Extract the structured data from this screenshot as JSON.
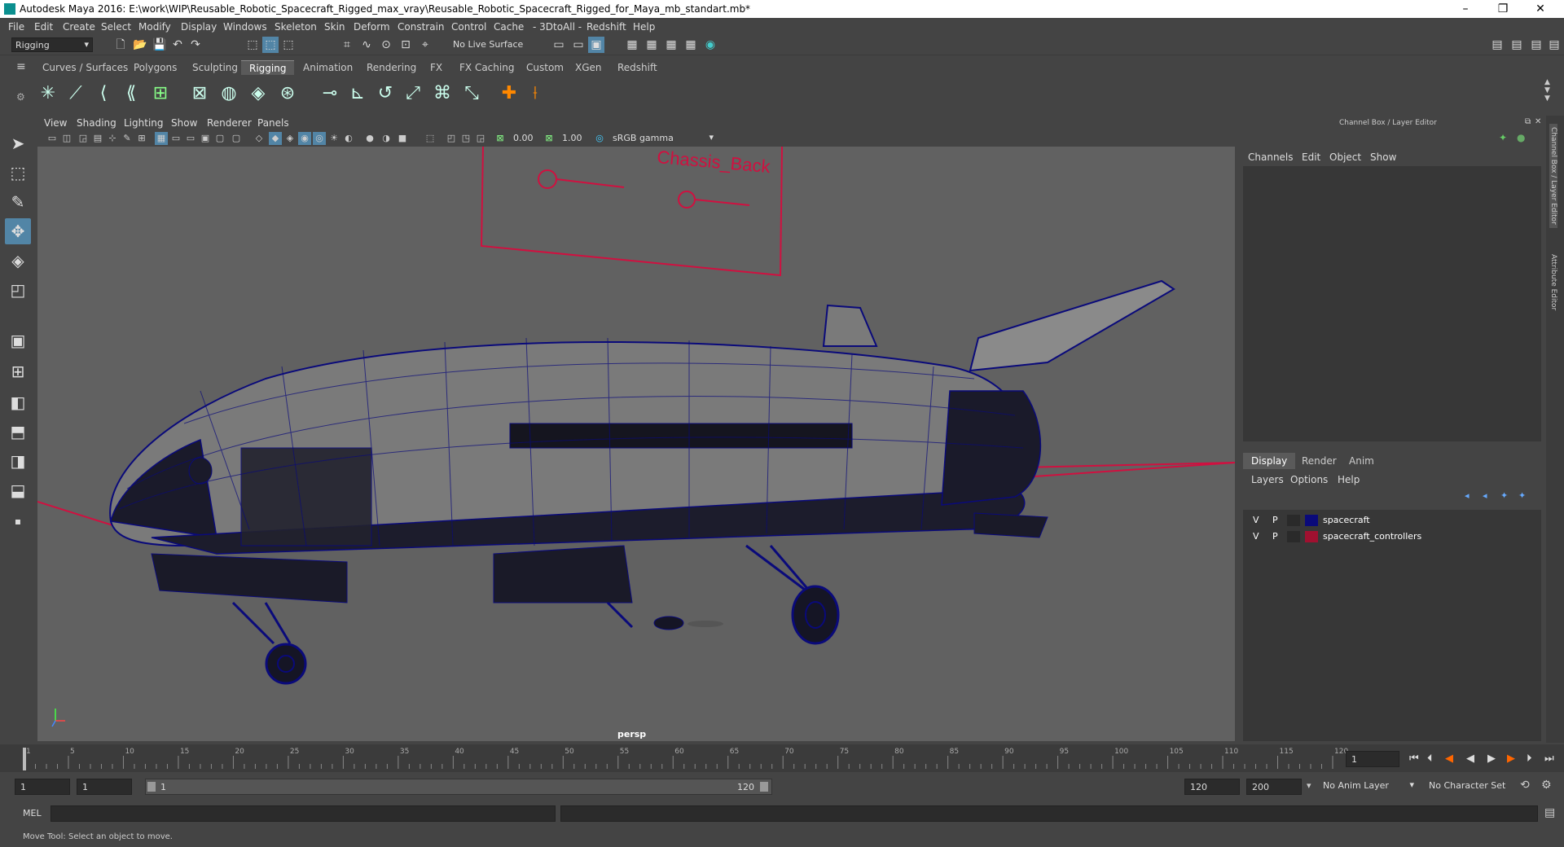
{
  "window": {
    "title": "Autodesk Maya 2016: E:\\work\\WIP\\Reusable_Robotic_Spacecraft_Rigged_max_vray\\Reusable_Robotic_Spacecraft_Rigged_for_Maya_mb_standart.mb*",
    "minimize": "–",
    "maximize": "❐",
    "close": "✕"
  },
  "menubar": [
    "File",
    "Edit",
    "Create",
    "Select",
    "Modify",
    "Display",
    "Windows",
    "Skeleton",
    "Skin",
    "Deform",
    "Constrain",
    "Control",
    "Cache",
    "- 3DtoAll -",
    "Redshift",
    "Help"
  ],
  "statusline": {
    "menuset": "Rigging",
    "live_surface": "No Live Surface"
  },
  "shelf_tabs": [
    "Curves / Surfaces",
    "Polygons",
    "Sculpting",
    "Rigging",
    "Animation",
    "Rendering",
    "FX",
    "FX Caching",
    "Custom",
    "XGen",
    "Redshift"
  ],
  "active_shelf_tab": "Rigging",
  "viewport": {
    "menus": [
      "View",
      "Shading",
      "Lighting",
      "Show",
      "Renderer",
      "Panels"
    ],
    "exposure": "0.00",
    "gamma": "1.00",
    "colorspace": "sRGB gamma",
    "camera_label": "persp",
    "annotation": "Chassis_Back"
  },
  "right_panel": {
    "title": "Channel Box / Layer Editor",
    "channel_menus": [
      "Channels",
      "Edit",
      "Object",
      "Show"
    ],
    "layer_tabs": [
      "Display",
      "Render",
      "Anim"
    ],
    "active_layer_tab": "Display",
    "layer_menus": [
      "Layers",
      "Options",
      "Help"
    ],
    "layers": [
      {
        "v": "V",
        "p": "P",
        "name": "spacecraft",
        "color": "#0a0a7a"
      },
      {
        "v": "V",
        "p": "P",
        "name": "spacecraft_controllers",
        "color": "#a01030"
      }
    ],
    "side_tabs": [
      "Channel Box / Layer Editor",
      "Attribute Editor"
    ]
  },
  "timeline": {
    "ticks": [
      "1",
      "5",
      "10",
      "15",
      "20",
      "25",
      "30",
      "35",
      "40",
      "45",
      "50",
      "55",
      "60",
      "65",
      "70",
      "75",
      "80",
      "85",
      "90",
      "95",
      "100",
      "105",
      "110",
      "115",
      "120"
    ],
    "current_frame": "1"
  },
  "range": {
    "start": "1",
    "playback_start": "1",
    "slider_start": "1",
    "slider_end": "120",
    "playback_end": "120",
    "end": "200",
    "anim_layer": "No Anim Layer",
    "character_set": "No Character Set"
  },
  "cmdline": {
    "label": "MEL"
  },
  "helpline": {
    "text": "Move Tool: Select an object to move."
  }
}
